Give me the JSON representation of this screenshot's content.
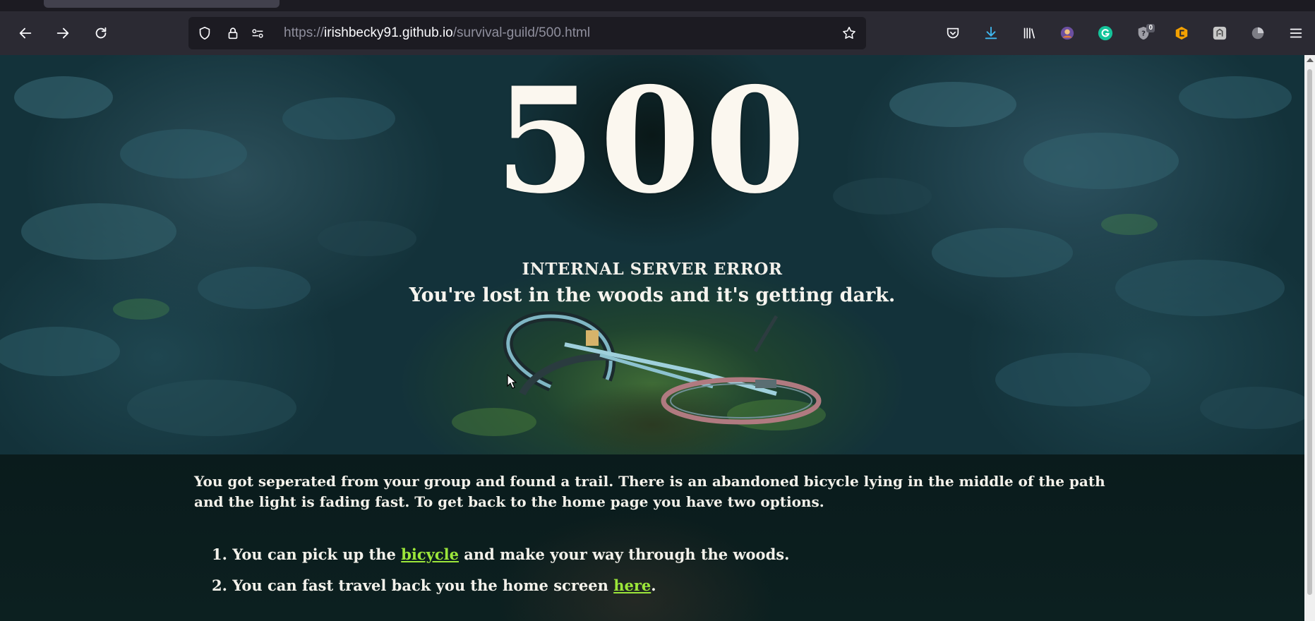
{
  "browser": {
    "url_prefix": "https://",
    "url_host": "irishbecky91.github.io",
    "url_path": "/survival-guild/500.html",
    "extension_badge_count": "0",
    "icons": [
      "back-icon",
      "forward-icon",
      "reload-icon",
      "shield-icon",
      "lock-icon",
      "permissions-icon",
      "bookmark-star-icon",
      "pocket-icon",
      "downloads-icon",
      "library-icon",
      "extension-avatar-icon",
      "grammarly-icon",
      "privacy-badger-icon",
      "extension-orange-icon",
      "extension-gray-icon",
      "extension-pie-icon",
      "menu-icon"
    ]
  },
  "page": {
    "error_code": "500",
    "error_title": "INTERNAL SERVER ERROR",
    "error_subtitle": "You're lost in the woods and it's getting dark.",
    "intro_text": "You got seperated from your group and found a trail. There is an abandoned bicycle lying in the middle of the path and the light is fading fast. To get back to the home page you have two options.",
    "options": [
      {
        "number": "1.",
        "before": "You can pick up the",
        "link": "bicycle",
        "after": "and make your way through the woods."
      },
      {
        "number": "2.",
        "before": "You can fast travel back you the home screen",
        "link": "here",
        "after": "."
      }
    ]
  },
  "colors": {
    "link": "#9ce63a",
    "text": "#f3f1ea",
    "content_bg": "#0b1d1f"
  }
}
